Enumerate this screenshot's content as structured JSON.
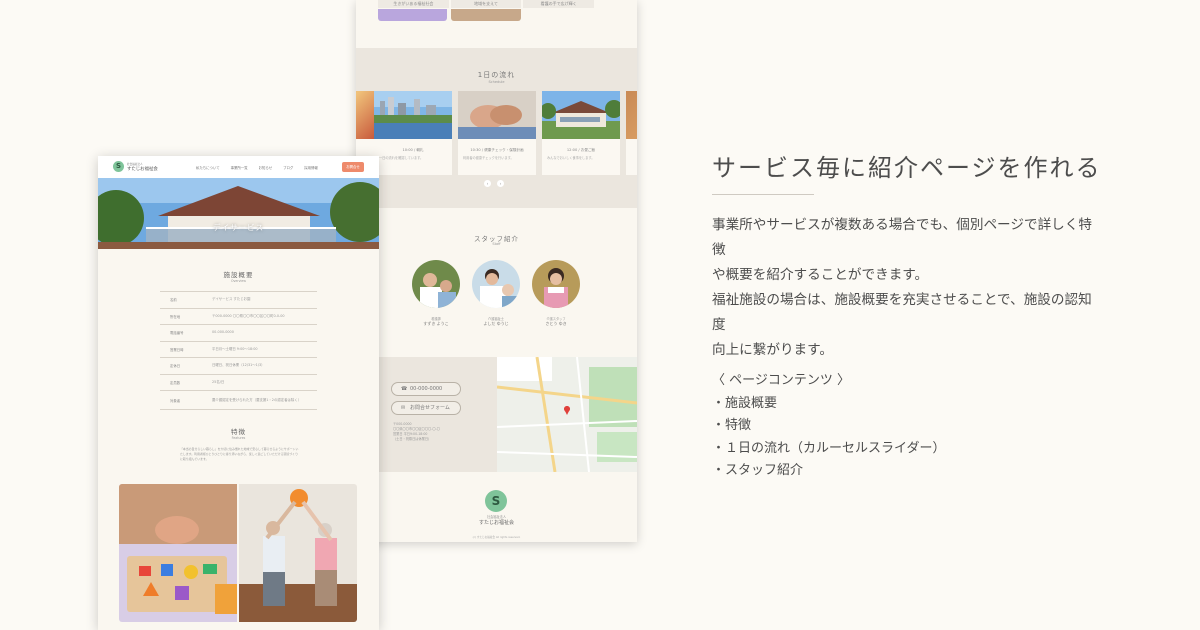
{
  "back_page": {
    "top_links": [
      "生きがいある福祉社会",
      "地域を支えて",
      "看護の手で広げ輝く"
    ],
    "flow": {
      "title": "1日の流れ",
      "subtitle": "Schedule",
      "cards": [
        {
          "time": "10:00 / 朝礼",
          "text": "一日の流れを確認しています。"
        },
        {
          "time": "10:30 / 健康チェック・保険計画",
          "text": "利用者の健康チェックを行います。"
        },
        {
          "time": "12:00 / お昼ご飯",
          "text": "みんなでおいしく食事をします。"
        }
      ],
      "prev_label": "‹",
      "next_label": "›"
    },
    "staff": {
      "title": "スタッフ紹介",
      "subtitle": "Staff",
      "members": [
        {
          "role": "看護師",
          "name": "すずき ようこ"
        },
        {
          "role": "介護福祉士",
          "name": "よしだ ゆうじ"
        },
        {
          "role": "介護スタッフ",
          "name": "さとう ゆき"
        }
      ]
    },
    "contact": {
      "phone": "00-000-0000",
      "form_label": "お問合せフォーム",
      "address_lines": [
        "〒000-0000",
        "〇〇県〇〇市〇〇区〇〇〇-〇-〇",
        "営業日 平日9:00-18:00",
        "（土日・祝祭日は休業日）"
      ]
    },
    "footer": {
      "logo_letter": "S",
      "org_small": "社会福祉法人",
      "org_name": "すたじお福祉会",
      "copyright": "(c) すたじお福祉会 All rights reserved."
    }
  },
  "front_page": {
    "nav": {
      "logo_letter": "S",
      "brand_small": "社会福祉法人",
      "brand": "すたじお福祉会",
      "items": [
        "私たちについて",
        "事業所一覧",
        "お知らせ",
        "ブログ",
        "採用情報"
      ],
      "cta": "お問合せ"
    },
    "hero_title": "デイサービス",
    "overview": {
      "title": "施設概要",
      "subtitle": "Overview",
      "rows": [
        {
          "k": "名前",
          "v": "デイサービス すたじお園"
        },
        {
          "k": "所在地",
          "v": "〒000-0000 〇〇県〇〇市〇〇区〇〇町0-0-00"
        },
        {
          "k": "電話番号",
          "v": "00-000-0000"
        },
        {
          "k": "営業日時",
          "v": "平日月〜土曜日 9:00〜18:00"
        },
        {
          "k": "定休日",
          "v": "日曜日、祝日休業（12/31〜1/3）"
        },
        {
          "k": "定員数",
          "v": "25名/日"
        },
        {
          "k": "対象者",
          "v": "要介護認定を受けられた方（要支援1・2の認定者は除く）"
        }
      ]
    },
    "feature": {
      "title": "特徴",
      "subtitle": "Features",
      "text": "「本当の自分らしい暮らし」を大切に住み慣れた地域で安心して暮らせるようにサポートいたします。利用者様ひとりひとりに寄り添いながら、楽しく過ごしていただける環境づくりに取り組んでいます。"
    }
  },
  "headline": "サービス毎に紹介ページを作れる",
  "description": [
    "事業所やサービスが複数ある場合でも、個別ページで詳しく特徴",
    "や概要を紹介することができます。",
    "福祉施設の場合は、施設概要を充実させることで、施設の認知度",
    "向上に繋がります。"
  ],
  "contents": [
    "〈 ページコンテンツ 〉",
    "・施設概要",
    "・特徴",
    "・１日の流れ（カルーセルスライダー）",
    "・スタッフ紹介"
  ],
  "colors": {
    "background": "#fcfaf5",
    "accent_green": "#7fc49a",
    "accent_orange": "#ee8a6b",
    "band": "#ebe6de"
  }
}
